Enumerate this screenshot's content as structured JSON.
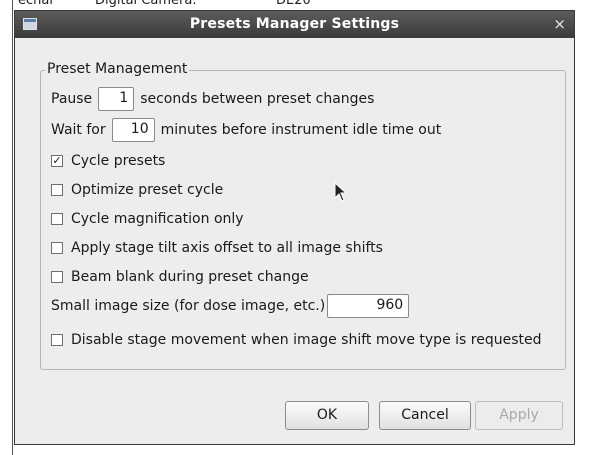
{
  "background": {
    "col1": "echar",
    "col2": "Digital Camera:",
    "col3": "DE20"
  },
  "dialog": {
    "title": "Presets Manager Settings",
    "close_glyph": "×"
  },
  "group": {
    "title": "Preset Management",
    "pause": {
      "label_before": "Pause",
      "value": "1",
      "label_after": "seconds between preset changes"
    },
    "wait": {
      "label_before": "Wait for",
      "value": "10",
      "label_after": "minutes before instrument idle time out"
    },
    "checkboxes": [
      {
        "label": "Cycle presets",
        "checked": true
      },
      {
        "label": "Optimize preset cycle",
        "checked": false
      },
      {
        "label": "Cycle magnification only",
        "checked": false
      },
      {
        "label": "Apply stage tilt axis offset to all image shifts",
        "checked": false
      },
      {
        "label": "Beam blank during preset change",
        "checked": false
      }
    ],
    "small_image": {
      "label": "Small image size (for dose image, etc.)",
      "value": "960"
    },
    "disable_stage": {
      "label": "Disable stage movement when image shift move type is requested",
      "checked": false
    }
  },
  "buttons": {
    "ok": "OK",
    "cancel": "Cancel",
    "apply": "Apply"
  },
  "icons": {
    "check": "☑",
    "cursor": "mouse-pointer-icon"
  }
}
